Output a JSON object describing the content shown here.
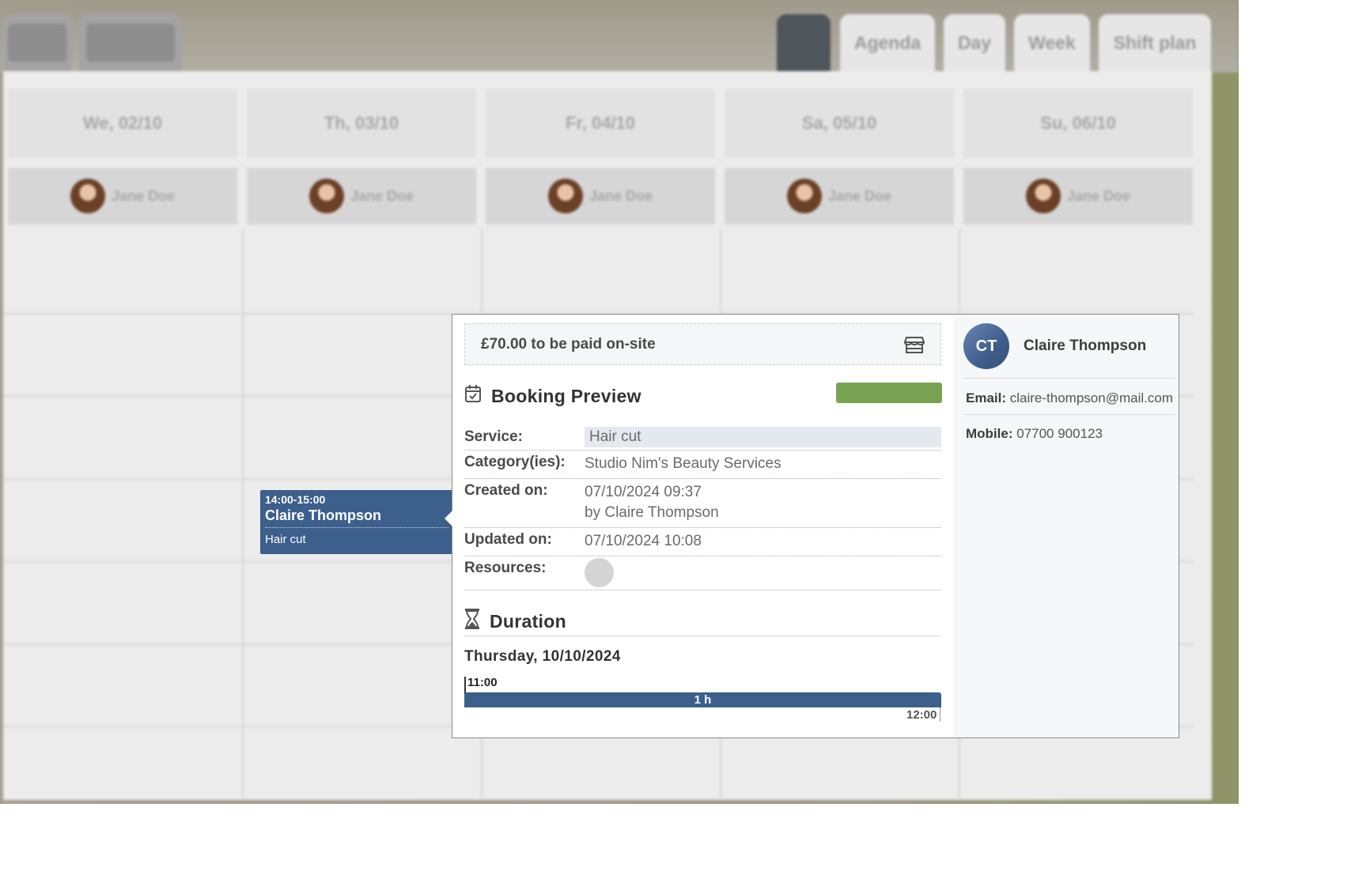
{
  "nav": {
    "views": [
      "Agenda",
      "Day",
      "Week",
      "Shift plan"
    ]
  },
  "calendar": {
    "days": [
      {
        "label": "We, 02/10",
        "staff": "Jane Doe"
      },
      {
        "label": "Th, 03/10",
        "staff": "Jane Doe"
      },
      {
        "label": "Fr, 04/10",
        "staff": "Jane Doe"
      },
      {
        "label": "Sa, 05/10",
        "staff": "Jane Doe"
      },
      {
        "label": "Su, 06/10",
        "staff": "Jane Doe"
      }
    ],
    "event": {
      "time": "14:00-15:00",
      "customer": "Claire Thompson",
      "service": "Hair cut"
    }
  },
  "preview": {
    "payment_text": "£70.00 to be paid on-site",
    "title": "Booking Preview",
    "status_color": "#79a352",
    "fields": {
      "service_label": "Service:",
      "service_value": "Hair cut",
      "category_label": "Category(ies):",
      "category_value": "Studio Nim's Beauty Services",
      "created_label": "Created on:",
      "created_value": "07/10/2024 09:37",
      "created_by": "by Claire Thompson",
      "updated_label": "Updated on:",
      "updated_value": "07/10/2024 10:08",
      "resources_label": "Resources:"
    },
    "duration": {
      "title": "Duration",
      "date": "Thursday, 10/10/2024",
      "start": "11:00",
      "length": "1 h",
      "end": "12:00"
    }
  },
  "customer": {
    "initials": "CT",
    "name": "Claire Thompson",
    "email_label": "Email:",
    "email": "claire-thompson@mail.com",
    "mobile_label": "Mobile:",
    "mobile": "07700 900123"
  }
}
